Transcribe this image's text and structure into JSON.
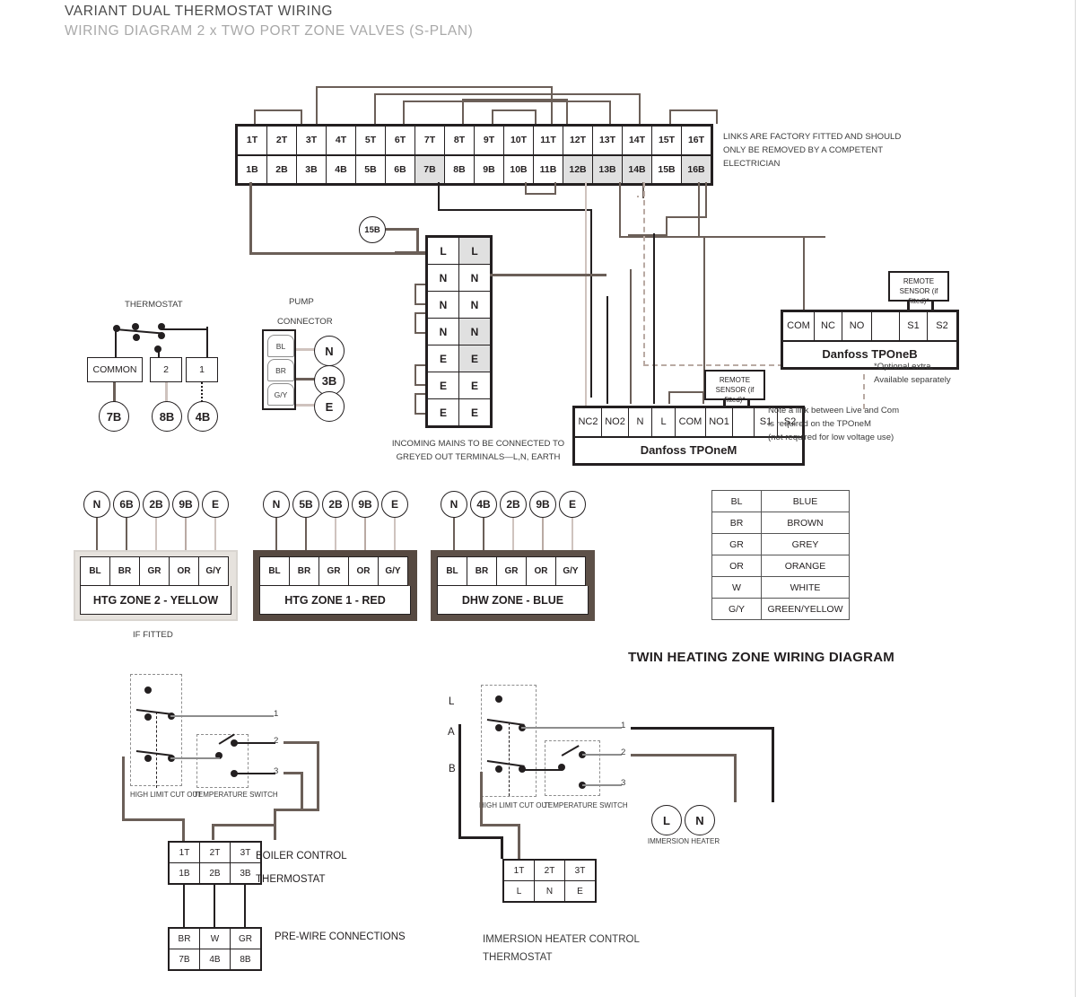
{
  "headings": {
    "title": "VARIANT DUAL THERMOSTAT WIRING",
    "subtitle": "WIRING DIAGRAM 2 x TWO PORT ZONE VALVES (S-PLAN)",
    "twin_zone": "TWIN HEATING ZONE WIRING DIAGRAM"
  },
  "notes": {
    "links_note": "LINKS ARE FACTORY FITTED AND SHOULD\nONLY BE REMOVED BY A COMPETENT\nELECTRICIAN",
    "incoming_mains": "INCOMING MAINS TO BE CONNECTED TO\nGREYED OUT TERMINALS—L,N, EARTH",
    "optional_extra": "*Optional extra.\nAvailable separately",
    "tponem_link": "Note a link between Live and Com\nis required on the TPOneM\n(not required for low voltage use)",
    "if_fitted": "IF FITTED",
    "remote_sensor": "REMOTE SENSOR\n(if fitted)*"
  },
  "main_strip": {
    "top": [
      "1T",
      "2T",
      "3T",
      "4T",
      "5T",
      "6T",
      "7T",
      "8T",
      "9T",
      "10T",
      "11T",
      "12T",
      "13T",
      "14T",
      "15T",
      "16T"
    ],
    "bottom": [
      "1B",
      "2B",
      "3B",
      "4B",
      "5B",
      "6B",
      "7B",
      "8B",
      "9B",
      "10B",
      "11B",
      "12B",
      "13B",
      "14B",
      "15B",
      "16B"
    ],
    "shaded_bottom": [
      "7B",
      "12B",
      "13B",
      "14B",
      "16B"
    ]
  },
  "lne_block": {
    "rows": [
      {
        "left": "L",
        "right": "L",
        "right_shaded": true
      },
      {
        "left": "N",
        "right": "N",
        "right_shaded": false
      },
      {
        "left": "N",
        "right": "N",
        "right_shaded": false
      },
      {
        "left": "N",
        "right": "N",
        "right_shaded": true
      },
      {
        "left": "E",
        "right": "E",
        "right_shaded": true
      },
      {
        "left": "E",
        "right": "E",
        "right_shaded": false
      },
      {
        "left": "E",
        "right": "E",
        "right_shaded": false
      }
    ],
    "feed_bubble": "15B"
  },
  "thermostat": {
    "title": "THERMOSTAT",
    "boxes": [
      "COMMON",
      "2",
      "1"
    ],
    "bubbles": [
      "7B",
      "8B",
      "4B"
    ]
  },
  "pump": {
    "title_line1": "PUMP",
    "title_line2": "CONNECTOR",
    "pins": [
      "BL",
      "BR",
      "G/Y"
    ],
    "bubbles": [
      "N",
      "3B",
      "E"
    ]
  },
  "tponem": {
    "name": "Danfoss TPOneM",
    "terminals": [
      "NC2",
      "NO2",
      "N",
      "L",
      "COM",
      "NO1",
      "",
      "S1",
      "S2"
    ]
  },
  "tponeb": {
    "name": "Danfoss TPOneB",
    "terminals": [
      "COM",
      "NC",
      "NO",
      "",
      "S1",
      "S2"
    ]
  },
  "zones": [
    {
      "name": "HTG ZONE 2 - YELLOW",
      "style": "yellow",
      "cores": [
        "BL",
        "BR",
        "GR",
        "OR",
        "G/Y"
      ],
      "bubbles": [
        "N",
        "6B",
        "2B",
        "9B",
        "E"
      ],
      "caption": "IF FITTED"
    },
    {
      "name": "HTG ZONE 1 - RED",
      "style": "red",
      "cores": [
        "BL",
        "BR",
        "GR",
        "OR",
        "G/Y"
      ],
      "bubbles": [
        "N",
        "5B",
        "2B",
        "9B",
        "E"
      ],
      "caption": ""
    },
    {
      "name": "DHW ZONE - BLUE",
      "style": "blue",
      "cores": [
        "BL",
        "BR",
        "GR",
        "OR",
        "G/Y"
      ],
      "bubbles": [
        "N",
        "4B",
        "2B",
        "9B",
        "E"
      ],
      "caption": ""
    }
  ],
  "legend": {
    "rows": [
      {
        "code": "BL",
        "name": "BLUE"
      },
      {
        "code": "BR",
        "name": "BROWN"
      },
      {
        "code": "GR",
        "name": "GREY"
      },
      {
        "code": "OR",
        "name": "ORANGE"
      },
      {
        "code": "W",
        "name": "WHITE"
      },
      {
        "code": "G/Y",
        "name": "GREEN/YELLOW"
      }
    ]
  },
  "boiler_control": {
    "high_limit": "HIGH LIMIT\nCUT OUT",
    "temp_switch": "TEMPERATURE\nSWITCH",
    "contacts": [
      "1",
      "2",
      "3"
    ],
    "strip_top": [
      "1T",
      "2T",
      "3T"
    ],
    "strip_bottom": [
      "1B",
      "2B",
      "3B"
    ],
    "label_line1": "BOILER CONTROL",
    "label_line2": "THERMOSTAT",
    "prewire_top": [
      "BR",
      "W",
      "GR"
    ],
    "prewire_bottom": [
      "7B",
      "4B",
      "8B"
    ],
    "prewire_label": "PRE-WIRE CONNECTIONS"
  },
  "immersion": {
    "high_limit": "HIGH LIMIT\nCUT OUT",
    "temp_switch": "TEMPERATURE\nSWITCH",
    "terminals_left": [
      "L",
      "A",
      "B"
    ],
    "contacts": [
      "1",
      "2",
      "3"
    ],
    "heater_bubbles": [
      "L",
      "N"
    ],
    "heater_label": "IMMERSION\nHEATER",
    "strip_top": [
      "1T",
      "2T",
      "3T"
    ],
    "strip_bottom": [
      "L",
      "N",
      "E"
    ],
    "label": "IMMERSION HEATER CONTROL\nTHERMOSTAT"
  },
  "colors": {
    "wire_brown": "#6b5f58",
    "wire_dark": "#231f20",
    "wire_pale": "#cfc3be",
    "wire_grey": "#8d8d8d",
    "shade": "#e0e0e0"
  }
}
